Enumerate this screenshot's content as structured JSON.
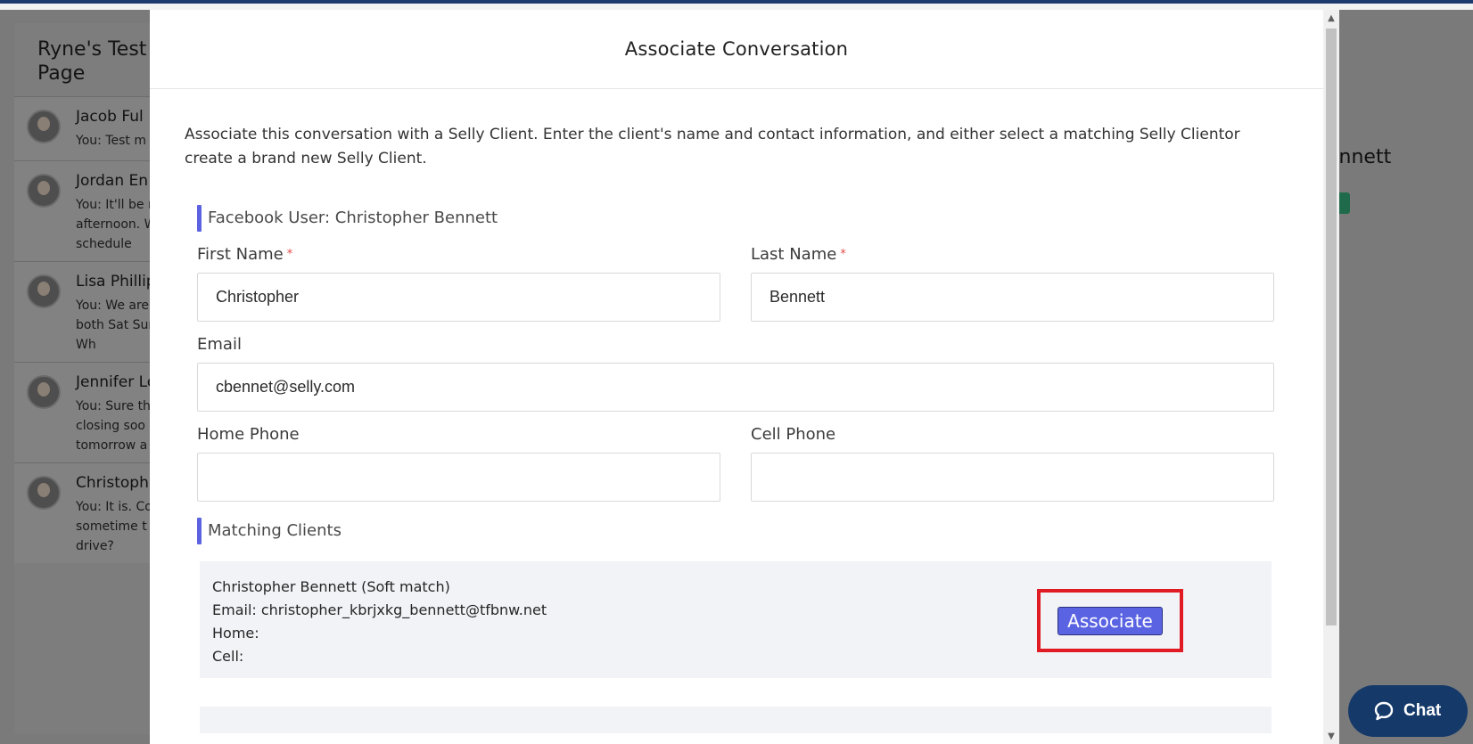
{
  "background": {
    "page_title": "Ryne's Test Page",
    "conversations": [
      {
        "name": "Jacob Ful",
        "snippet": "You: Test m"
      },
      {
        "name": "Jordan En",
        "snippet": "You: It'll be r afternoon. W to schedule"
      },
      {
        "name": "Lisa Phillip",
        "snippet": "You: We are on both Sat Sunday. Wh"
      },
      {
        "name": "Jennifer Le",
        "snippet": "You: Sure th closing soo tomorrow a"
      },
      {
        "name": "Christoph",
        "snippet": "You: It is. Co sometime t drive?"
      }
    ],
    "right_name_fragment": "ennett"
  },
  "modal": {
    "title": "Associate Conversation",
    "intro": "Associate this conversation with a Selly Client. Enter the client's name and contact information, and either select a matching Selly Clientor create a brand new Selly Client.",
    "facebook_user_heading": "Facebook User: Christopher Bennett",
    "fields": {
      "first_name": {
        "label": "First Name",
        "required_mark": "*",
        "value": "Christopher"
      },
      "last_name": {
        "label": "Last Name",
        "required_mark": "*",
        "value": "Bennett"
      },
      "email": {
        "label": "Email",
        "value": "cbennet@selly.com"
      },
      "home_phone": {
        "label": "Home Phone",
        "value": ""
      },
      "cell_phone": {
        "label": "Cell Phone",
        "value": ""
      }
    },
    "matching_heading": "Matching Clients",
    "matches": [
      {
        "title": "Christopher Bennett (Soft match)",
        "email_line": "Email: christopher_kbrjxkg_bennett@tfbnw.net",
        "home_line": "Home:",
        "cell_line": "Cell:",
        "button_label": "Associate"
      }
    ]
  },
  "chat_widget": {
    "label": "Chat"
  },
  "colors": {
    "accent": "#5a64e3",
    "highlight": "#e01b24",
    "chat_bg": "#153a6a"
  }
}
